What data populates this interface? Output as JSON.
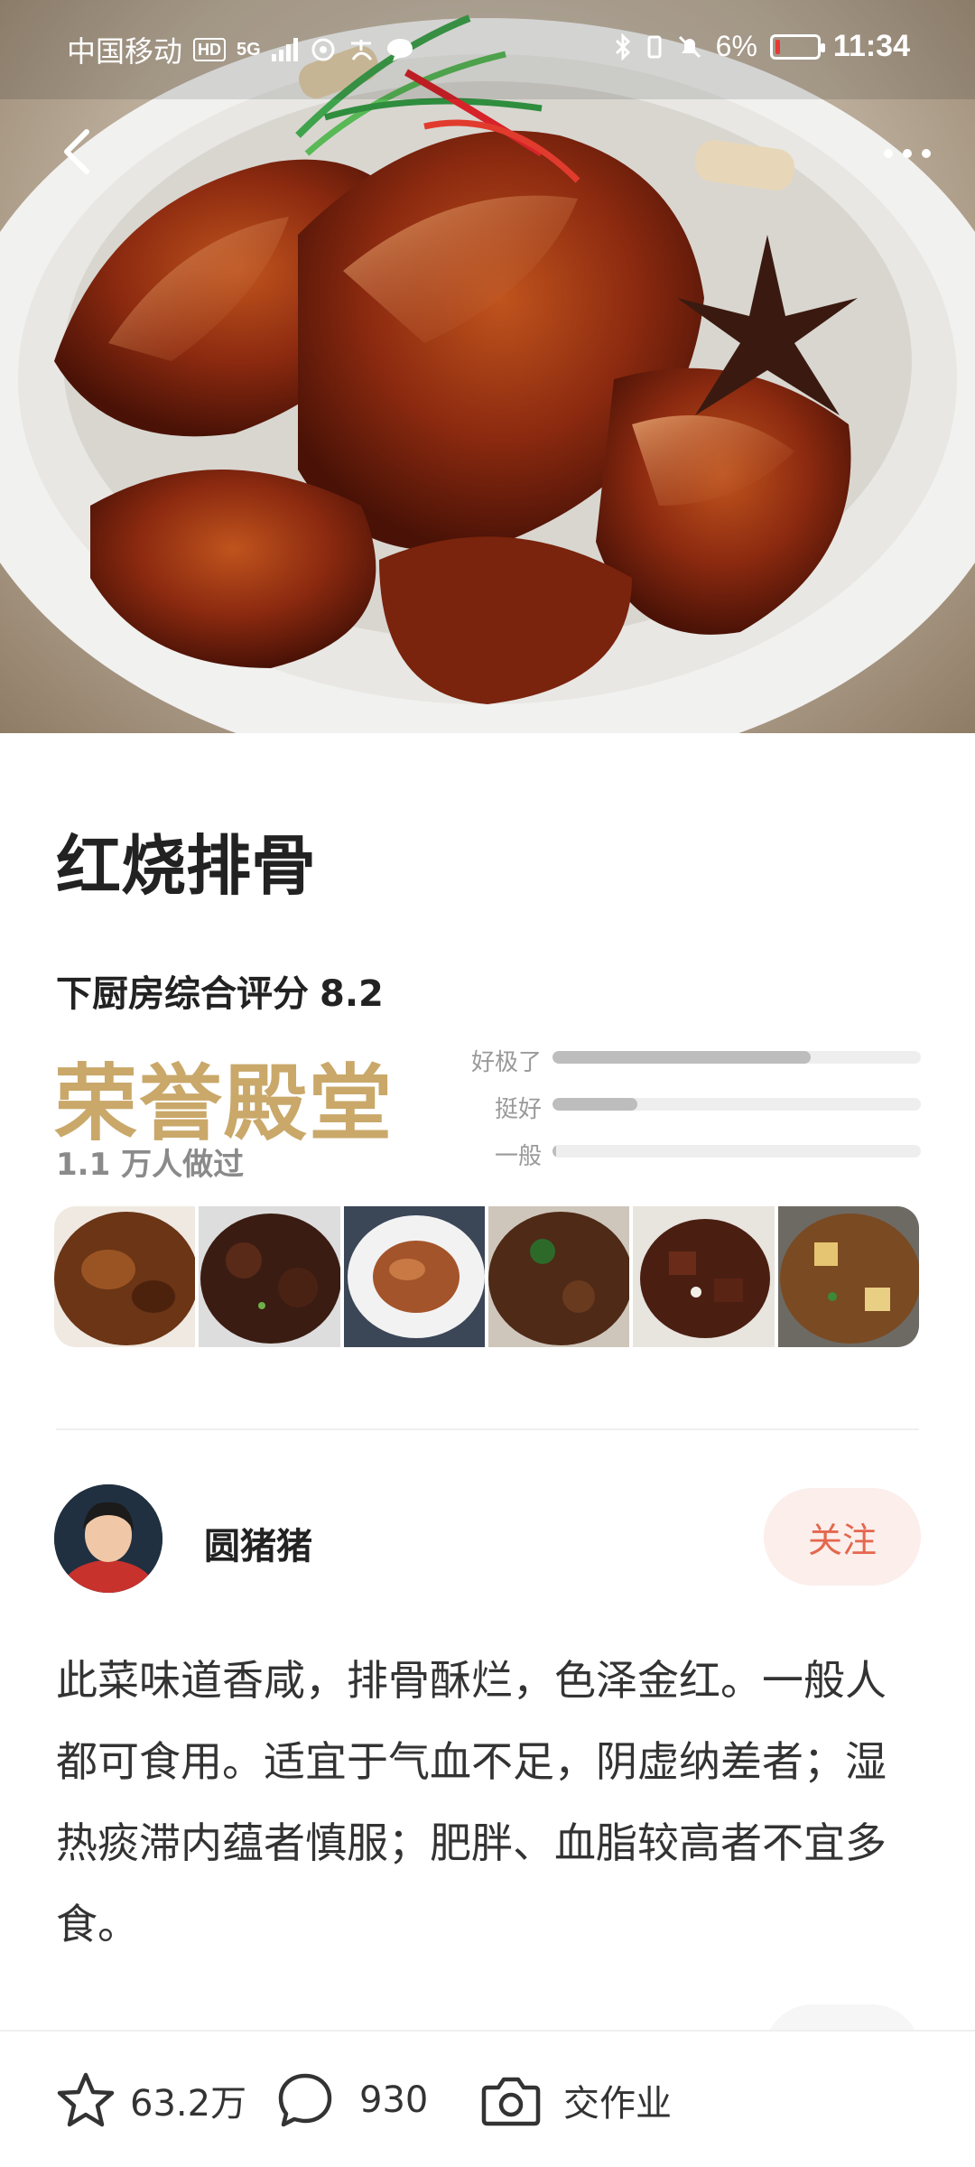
{
  "status_bar": {
    "carrier": "中国移动",
    "hd": "HD",
    "network": "5G",
    "battery": "6%",
    "battery_level_fraction": 0.06,
    "time": "11:34"
  },
  "recipe": {
    "title": "红烧排骨",
    "rating_label": "下厨房综合评分",
    "rating_score": "8.2",
    "honor": "荣誉殿堂",
    "cooked_count": "1.1 万人做过",
    "rating_bars": [
      {
        "label": "好极了",
        "fraction": 0.7
      },
      {
        "label": "挺好",
        "fraction": 0.23
      },
      {
        "label": "一般",
        "fraction": 0.01
      }
    ],
    "photo_count": 6
  },
  "author": {
    "name": "圆猪猪",
    "follow_label": "关注"
  },
  "description": "此菜味道香咸，排骨酥烂，色泽金红。一般人都可食用。适宜于气血不足，阴虚纳差者；湿热痰滞内蕴者慎服；肥胖、血脂较高者不宜多食。",
  "bottom_bar": {
    "favorites": "63.2万",
    "comments": "930",
    "homework": "交作业"
  },
  "colors": {
    "honor_gold": "#c9a86a",
    "follow_text": "#e4674e",
    "follow_bg": "#fbeeeb"
  },
  "icons": [
    "back-arrow-icon",
    "more-dots-icon",
    "star-icon",
    "comment-bubble-icon",
    "camera-icon"
  ]
}
